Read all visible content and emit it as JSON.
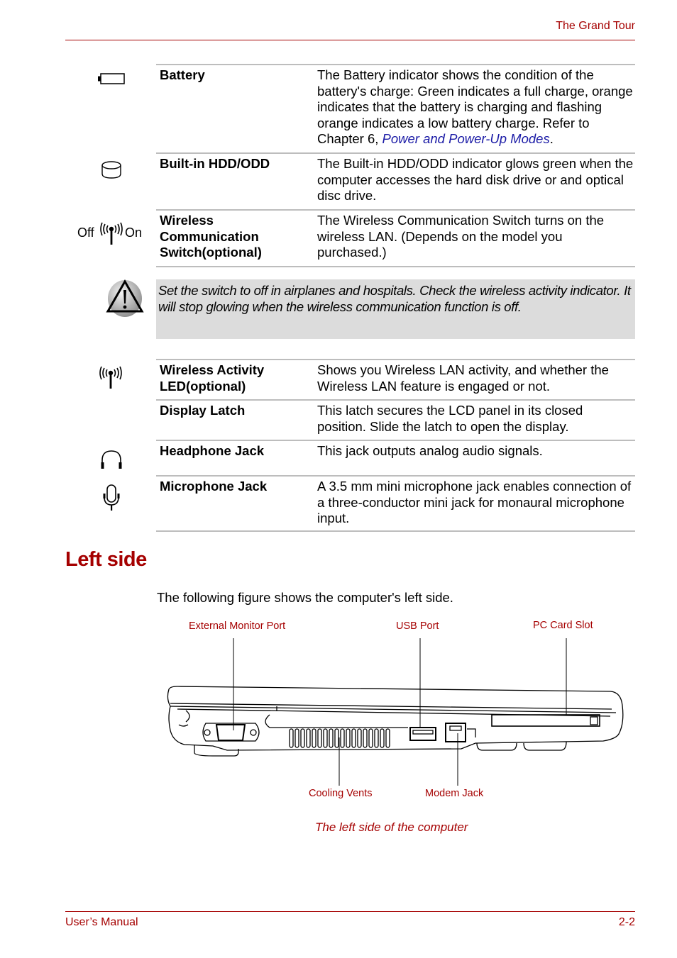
{
  "header": {
    "title": "The Grand Tour"
  },
  "table1": {
    "rows": [
      {
        "icon": "battery-icon",
        "term": "Battery",
        "desc": "The Battery indicator shows the condition of the battery's charge: Green indicates a full charge, orange indicates that the battery is charging and flashing orange indicates a low battery charge. Refer to Chapter 6, ",
        "link": "Power and Power-Up Modes",
        "desc_end": "."
      },
      {
        "icon": "hdd-icon",
        "term": "Built-in HDD/ODD",
        "desc": "The Built-in HDD/ODD indicator glows green when the computer accesses the hard disk drive or and optical disc drive."
      },
      {
        "icon": "wireless-switch-icon",
        "icon_off": "Off",
        "icon_on": "On",
        "term": "Wireless Communication Switch(optional)",
        "desc": "The Wireless Communication Switch turns on the wireless LAN. (Depends on the model you purchased.)"
      }
    ]
  },
  "note": {
    "icon": "warning-icon",
    "text": "Set the switch to off in airplanes and hospitals. Check the wireless activity indicator. It will stop glowing when the wireless communication function is off."
  },
  "table2": {
    "rows": [
      {
        "icon": "wireless-led-icon",
        "term": "Wireless Activity LED(optional)",
        "desc": "Shows you Wireless LAN activity, and whether the Wireless LAN feature is engaged or not."
      },
      {
        "icon": "",
        "term": "Display Latch",
        "desc": "This latch secures the LCD panel in its closed position. Slide the latch to open the display."
      },
      {
        "icon": "headphone-icon",
        "term": "Headphone Jack",
        "desc": "This jack outputs analog audio signals."
      },
      {
        "icon": "microphone-icon",
        "term": "Microphone Jack",
        "desc": "A 3.5 mm mini microphone jack enables connection of a three-conductor mini jack for monaural microphone input."
      }
    ]
  },
  "section": {
    "heading": "Left side",
    "intro": "The following figure shows the computer's left side."
  },
  "figure": {
    "labels": {
      "external_monitor": "External Monitor Port",
      "usb": "USB Port",
      "pc_card": "PC Card Slot",
      "cooling": "Cooling Vents",
      "modem": "Modem Jack"
    },
    "caption": "The left side of the computer"
  },
  "footer": {
    "left": "User’s Manual",
    "right": "2-2"
  }
}
